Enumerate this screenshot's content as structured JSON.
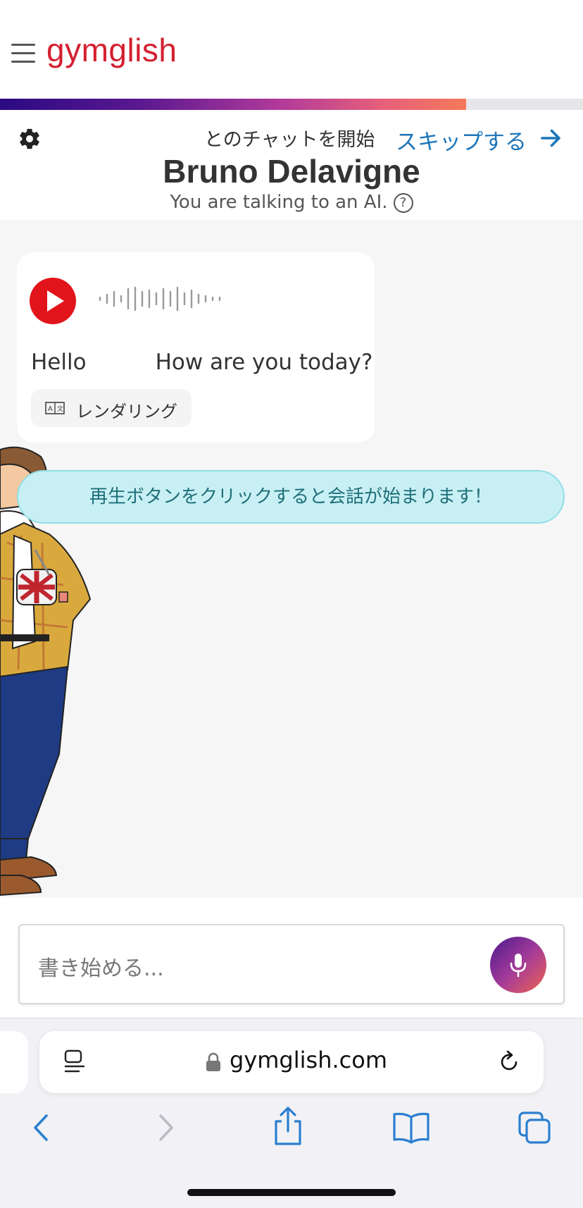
{
  "header": {
    "logo": "gymglish",
    "progress_fraction": 0.8,
    "chat_prefix": "とのチャットを開始",
    "skip_label": "スキップする",
    "bot_name": "Bruno Delavigne",
    "ai_note": "You are talking to an AI.",
    "help_glyph": "?"
  },
  "bubble": {
    "text_part1": "Hello",
    "text_part2": "How are you today?",
    "render_label": "レンダリング"
  },
  "hint": "再生ボタンをクリックすると会話が始まります！",
  "composer": {
    "placeholder": "書き始める..."
  },
  "browser": {
    "url": "gymglish.com"
  },
  "colors": {
    "brand_red": "#d42030",
    "link_blue": "#1c75b9",
    "play_red": "#e2141b",
    "hint_bg": "#c8f0f4",
    "safari_blue": "#2c7fd0"
  },
  "icons": [
    "menu-icon",
    "gear-icon",
    "arrow-right-icon",
    "help-icon",
    "play-icon",
    "waveform-icon",
    "translate-icon",
    "mic-icon",
    "reader-icon",
    "lock-icon",
    "reload-icon",
    "back-icon",
    "forward-icon",
    "share-icon",
    "bookmarks-icon",
    "tabs-icon"
  ]
}
